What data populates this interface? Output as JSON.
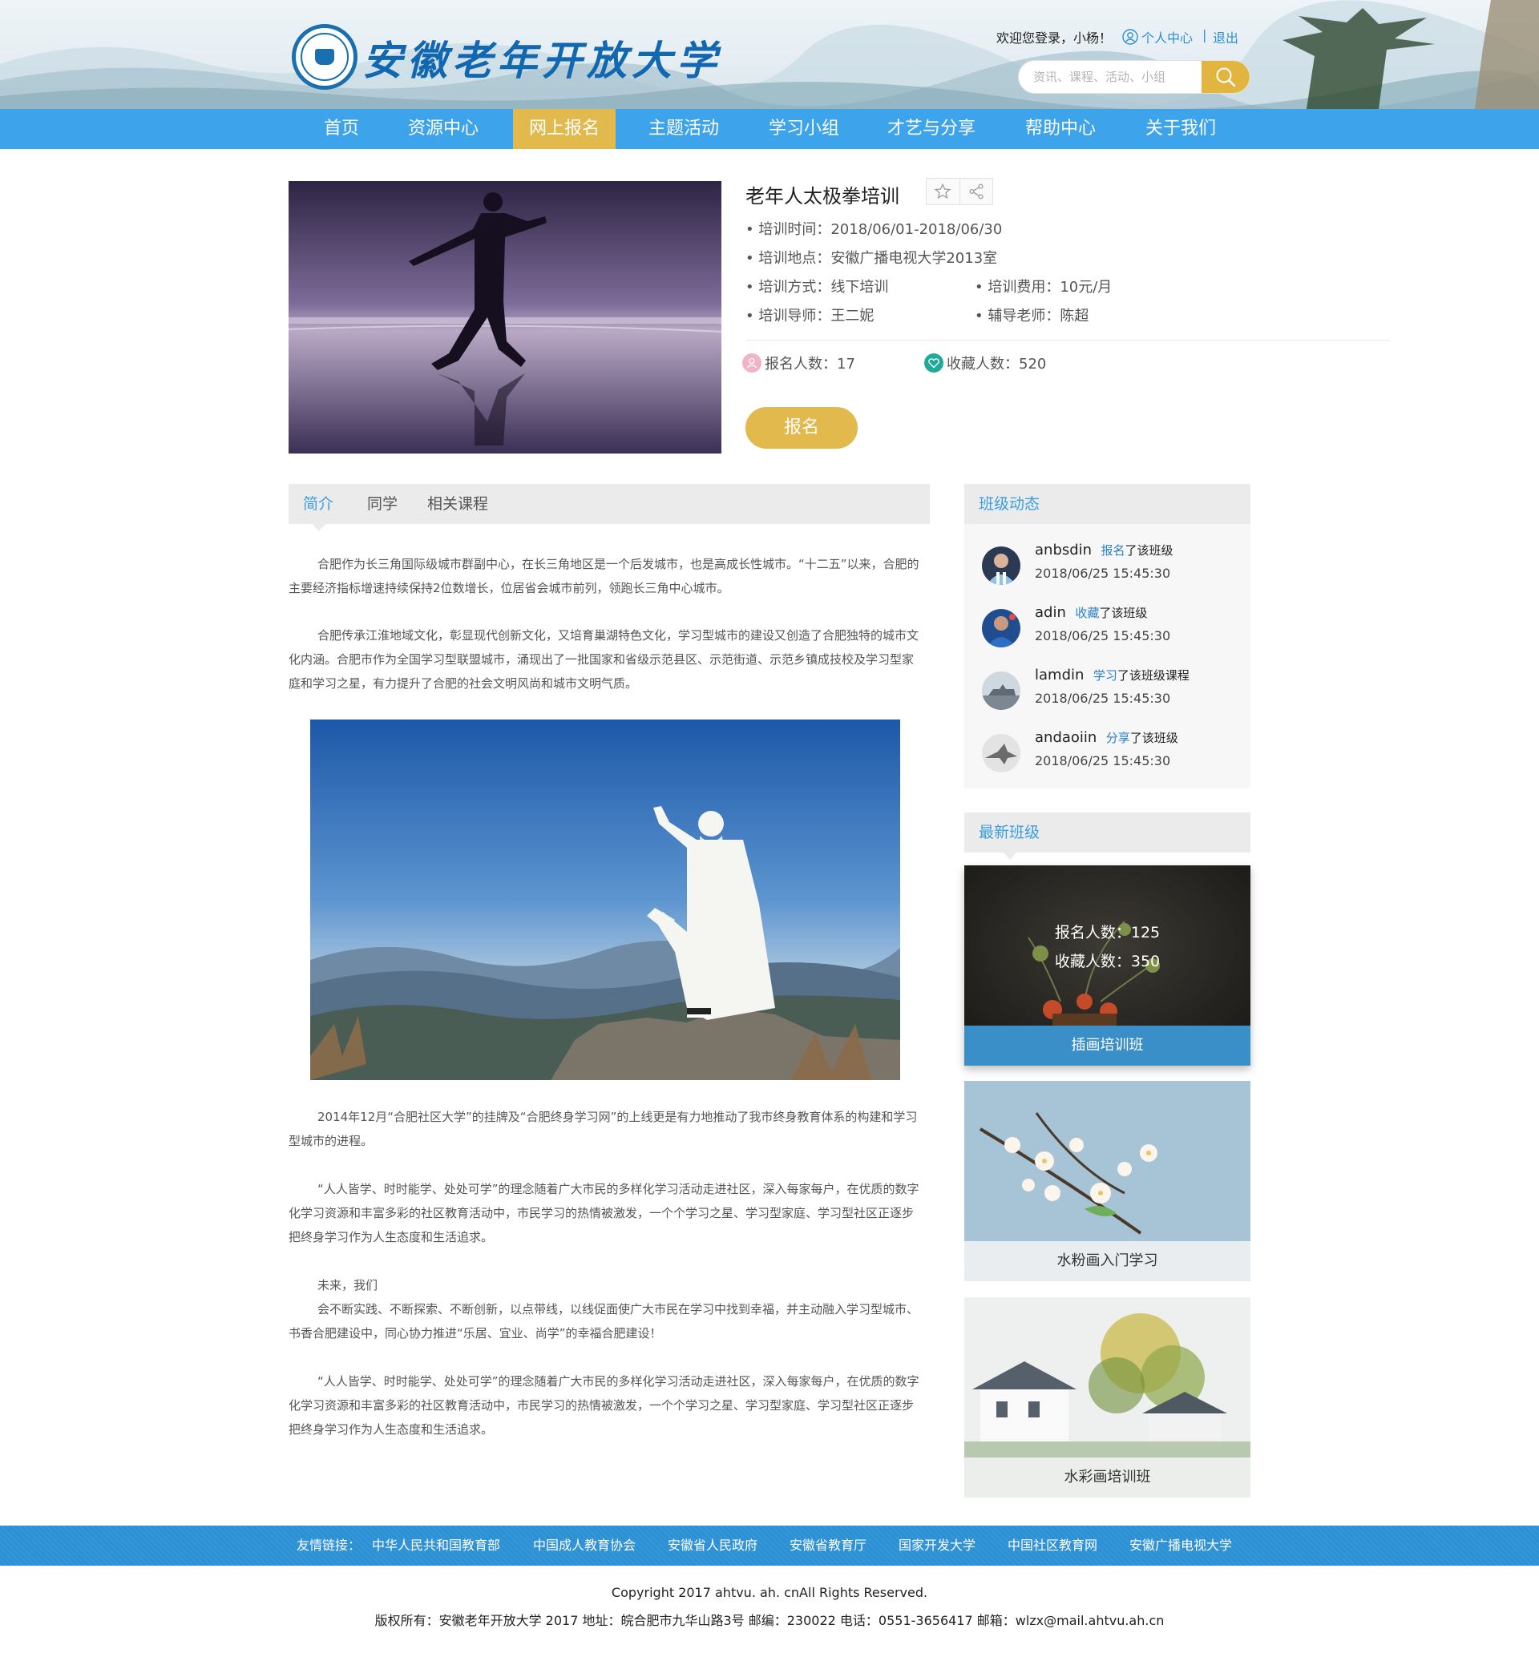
{
  "header": {
    "site_name": "安徽老年开放大学",
    "welcome": "欢迎您登录，小杨！",
    "user_center": "个人中心",
    "separator": "|",
    "logout": "退出",
    "search_placeholder": "资讯、课程、活动、小组"
  },
  "nav": {
    "items": [
      "首页",
      "资源中心",
      "网上报名",
      "主题活动",
      "学习小组",
      "才艺与分享",
      "帮助中心",
      "关于我们"
    ],
    "active": "网上报名"
  },
  "course": {
    "title": "老年人太极拳培训",
    "time": "• 培训时间：2018/06/01-2018/06/30",
    "place": "• 培训地点：安徽广播电视大学2013室",
    "mode": "• 培训方式：线下培训",
    "fee": "• 培训费用：10元/月",
    "mentor": "• 培训导师：王二妮",
    "tutor": "• 辅导老师：陈超",
    "signups": "报名人数：17",
    "favorites": "收藏人数：520",
    "signup_button": "报名"
  },
  "tabs": {
    "items": [
      "简介",
      "同学",
      "相关课程"
    ],
    "active": "简介"
  },
  "article": {
    "p1": "合肥作为长三角国际级城市群副中心，在长三角地区是一个后发城市，也是高成长性城市。“十二五”以来，合肥的主要经济指标增速持续保持2位数增长，位居省会城市前列，领跑长三角中心城市。",
    "p2": "合肥传承江淮地域文化，彰显现代创新文化，又培育巢湖特色文化，学习型城市的建设又创造了合肥独特的城市文化内涵。合肥市作为全国学习型联盟城市，涌现出了一批国家和省级示范县区、示范街道、示范乡镇成技校及学习型家庭和学习之星，有力提升了合肥的社会文明风尚和城市文明气质。",
    "p3": "2014年12月“合肥社区大学”的挂牌及“合肥终身学习网”的上线更是有力地推动了我市终身教育体系的构建和学习型城市的进程。",
    "p4": "“人人皆学、时时能学、处处可学”的理念随着广大市民的多样化学习活动走进社区，深入每家每户，在优质的数字化学习资源和丰富多彩的社区教育活动中，市民学习的热情被激发，一个个学习之星、学习型家庭、学习型社区正逐步把终身学习作为人生态度和生活追求。",
    "p5a": "未来，我们",
    "p5b": "会不断实践、不断探索、不断创新，以点带线，以线促面使广大市民在学习中找到幸福，并主动融入学习型城市、书香合肥建设中，同心协力推进“乐居、宜业、尚学”的幸福合肥建设！",
    "p6": "“人人皆学、时时能学、处处可学”的理念随着广大市民的多样化学习活动走进社区，深入每家每户，在优质的数字化学习资源和丰富多彩的社区教育活动中，市民学习的热情被激发，一个个学习之星、学习型家庭、学习型社区正逐步把终身学习作为人生态度和生活追求。"
  },
  "sidebar": {
    "activity_title": "班级动态",
    "activities": [
      {
        "user": "anbsdin",
        "verb": "报名",
        "rest": "了该班级",
        "time": "2018/06/25  15:45:30"
      },
      {
        "user": "adin",
        "verb": "收藏",
        "rest": "了该班级",
        "time": "2018/06/25  15:45:30"
      },
      {
        "user": "lamdin",
        "verb": "学习",
        "rest": "了该班级课程",
        "time": "2018/06/25  15:45:30"
      },
      {
        "user": "andaoiin",
        "verb": "分享",
        "rest": "了该班级",
        "time": "2018/06/25  15:45:30"
      }
    ],
    "latest_title": "最新班级",
    "classes": [
      {
        "name": "插画培训班",
        "signups": "报名人数：125",
        "favorites": "收藏人数：350"
      },
      {
        "name": "水粉画入门学习"
      },
      {
        "name": "水彩画培训班"
      }
    ]
  },
  "footer": {
    "links_label": "友情链接：",
    "links": [
      "中华人民共和国教育部",
      "中国成人教育协会",
      "安徽省人民政府",
      "安徽省教育厅",
      "国家开发大学",
      "中国社区教育网",
      "安徽广播电视大学"
    ],
    "copyright": "Copyright 2017 ahtvu. ah. cnAll Rights Reserved.",
    "record": "版权所有：安徽老年开放大学 2017 地址：皖合肥市九华山路3号 邮编：230022 电话：0551-3656417 邮箱：wlzx@mail.ahtvu.ah.cn"
  },
  "colors": {
    "nav_blue": "#3da3ea",
    "nav_active": "#e2b94d",
    "accent_blue": "#3d9edf",
    "footer_blue": "#2c90d5"
  }
}
